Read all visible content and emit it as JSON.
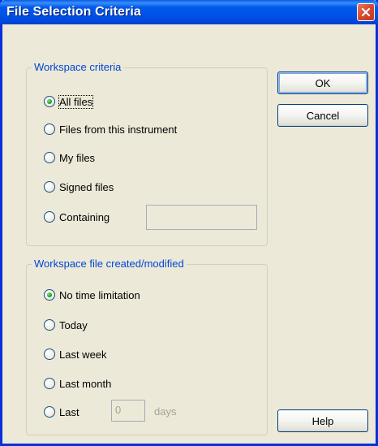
{
  "window": {
    "title": "File Selection Criteria"
  },
  "workspace_criteria": {
    "legend": "Workspace criteria",
    "options": [
      {
        "label": "All files",
        "checked": true
      },
      {
        "label": "Files from this instrument",
        "checked": false
      },
      {
        "label": "My files",
        "checked": false
      },
      {
        "label": "Signed files",
        "checked": false
      },
      {
        "label": "Containing",
        "checked": false
      }
    ],
    "containing_value": ""
  },
  "file_time": {
    "legend": "Workspace file created/modified",
    "options": [
      {
        "label": "No time limitation",
        "checked": true
      },
      {
        "label": "Today",
        "checked": false
      },
      {
        "label": "Last week",
        "checked": false
      },
      {
        "label": "Last month",
        "checked": false
      },
      {
        "label": "Last",
        "checked": false
      }
    ],
    "days_value": "0",
    "days_unit": "days"
  },
  "buttons": {
    "ok": "OK",
    "cancel": "Cancel",
    "help": "Help"
  },
  "icons": {
    "close": "close-icon"
  },
  "colors": {
    "titlebar": "#0054e3",
    "dialog_bg": "#ece9d8",
    "legend_text": "#0046d5",
    "close_button": "#d6492d",
    "radio_dot": "#21a121"
  }
}
